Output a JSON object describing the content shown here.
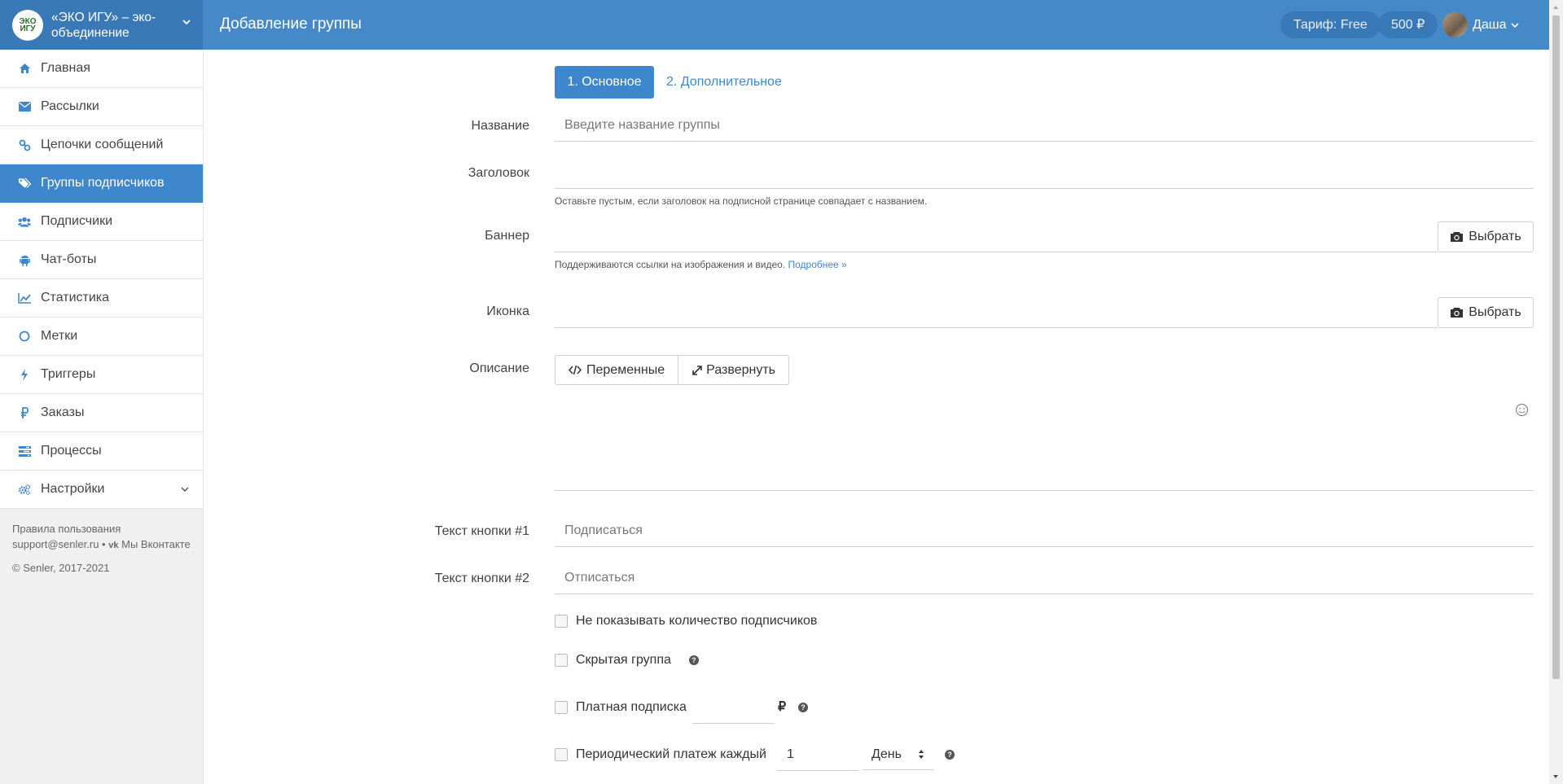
{
  "brand": {
    "name": "«ЭКО ИГУ» – эко-объединение",
    "logo_line1": "ЭКО",
    "logo_line2": "ИГУ"
  },
  "header": {
    "title": "Добавление группы",
    "tariff": "Тариф: Free",
    "balance": "500 ₽",
    "user_name": "Даша"
  },
  "sidebar": {
    "items": [
      {
        "label": "Главная",
        "icon": "home-icon"
      },
      {
        "label": "Рассылки",
        "icon": "envelope-icon"
      },
      {
        "label": "Цепочки сообщений",
        "icon": "link-icon"
      },
      {
        "label": "Группы подписчиков",
        "icon": "tags-icon",
        "active": true
      },
      {
        "label": "Подписчики",
        "icon": "users-icon"
      },
      {
        "label": "Чат-боты",
        "icon": "android-icon"
      },
      {
        "label": "Статистика",
        "icon": "line-chart-icon"
      },
      {
        "label": "Метки",
        "icon": "circle-icon"
      },
      {
        "label": "Триггеры",
        "icon": "bolt-icon"
      },
      {
        "label": "Заказы",
        "icon": "ruble-icon"
      },
      {
        "label": "Процессы",
        "icon": "tasks-icon"
      },
      {
        "label": "Настройки",
        "icon": "cogs-icon"
      }
    ],
    "footer": {
      "terms": "Правила пользования",
      "support": "support@senler.ru",
      "separator": "•",
      "vk": "Мы Вконтакте",
      "copyright": "© Senler, 2017-2021"
    }
  },
  "tabs": {
    "basic": "1. Основное",
    "extra": "2. Дополнительное"
  },
  "form": {
    "name_label": "Название",
    "name_placeholder": "Введите название группы",
    "heading_label": "Заголовок",
    "heading_hint": "Оставьте пустым, если заголовок на подписной странице совпадает с названием.",
    "banner_label": "Баннер",
    "banner_hint": "Поддерживаются ссылки на изображения и видео.",
    "banner_hint_link": "Подробнее »",
    "icon_label": "Иконка",
    "pick_label": "Выбрать",
    "desc_label": "Описание",
    "variables_label": "Переменные",
    "expand_label": "Развернуть",
    "btn1_label": "Текст кнопки #1",
    "btn1_placeholder": "Подписаться",
    "btn2_label": "Текст кнопки #2",
    "btn2_placeholder": "Отписаться",
    "hide_count_label": "Не показывать количество подписчиков",
    "hidden_group_label": "Скрытая группа",
    "paid_label": "Платная подписка",
    "currency": "₽",
    "periodic_label": "Периодический платеж каждый",
    "periodic_value": "1",
    "period_unit": "День"
  },
  "colors": {
    "header": "#4689c9",
    "brand": "#3a79b8",
    "accent": "#3f87cc"
  }
}
